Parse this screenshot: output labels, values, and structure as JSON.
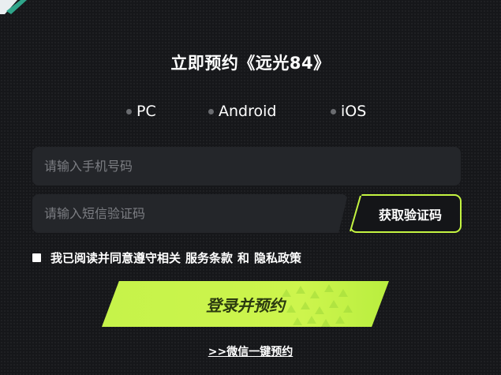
{
  "title": "立即预约《远光84》",
  "platforms": [
    {
      "label": "PC"
    },
    {
      "label": "Android"
    },
    {
      "label": "iOS"
    }
  ],
  "phone_input": {
    "placeholder": "请输入手机号码",
    "value": ""
  },
  "code_input": {
    "placeholder": "请输入短信验证码",
    "value": ""
  },
  "get_code_button": "获取验证码",
  "agreement": {
    "checked": false,
    "prefix": "我已阅读并同意遵守相关",
    "terms_link": "服务条款",
    "conjunction": "和",
    "privacy_link": "隐私政策"
  },
  "login_button": "登录并预约",
  "wechat_link": ">>微信一键预约",
  "colors": {
    "accent": "#c6f34a",
    "background": "#16171a",
    "input_bg": "#24262a"
  }
}
